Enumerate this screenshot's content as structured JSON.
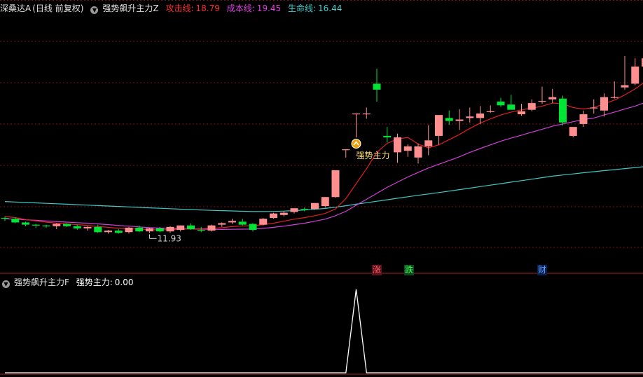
{
  "main_header": {
    "stock": "深桑达A",
    "period": "(日线 前复权)",
    "indicator": "强势飙升主力Z",
    "attack_label": "攻击线:",
    "attack_value": "18.79",
    "cost_label": "成本线:",
    "cost_value": "19.45",
    "life_label": "生命线:",
    "life_value": "16.44"
  },
  "sub_header": {
    "indicator": "强势飙升主力F",
    "strong_label": "强势主力:",
    "strong_value": "0.00"
  },
  "annotations": {
    "low_price": "11.93",
    "strong_signal": "强势主力",
    "rise_mark": "涨",
    "fall_mark": "跌",
    "money_mark": "财"
  },
  "colors": {
    "up": "#ff8f8f",
    "down": "#00e436",
    "attack": "#e02020",
    "cost": "#d040d8",
    "life": "#40c8c8",
    "grid": "#7a1616",
    "strong": "#ffffff",
    "label_yellow": "#ffe070"
  },
  "chart_data": {
    "type": "candlestick",
    "price_range": [
      10.6,
      26.1
    ],
    "candles": [
      [
        12.9,
        13.0,
        12.7,
        12.85
      ],
      [
        12.85,
        12.95,
        12.55,
        12.6
      ],
      [
        12.6,
        12.65,
        12.35,
        12.45
      ],
      [
        12.45,
        12.5,
        12.25,
        12.4
      ],
      [
        12.4,
        12.45,
        12.25,
        12.35
      ],
      [
        12.35,
        12.55,
        12.15,
        12.5
      ],
      [
        12.5,
        12.55,
        12.3,
        12.35
      ],
      [
        12.35,
        12.45,
        12.1,
        12.2
      ],
      [
        12.2,
        12.35,
        12.05,
        12.3
      ],
      [
        12.3,
        12.45,
        11.9,
        11.95
      ],
      [
        11.95,
        12.1,
        11.85,
        12.05
      ],
      [
        12.05,
        12.15,
        11.85,
        11.9
      ],
      [
        11.95,
        12.3,
        11.85,
        12.25
      ],
      [
        12.25,
        12.4,
        11.95,
        12.0
      ],
      [
        12.0,
        12.25,
        11.9,
        12.2
      ],
      [
        12.2,
        12.3,
        11.95,
        12.0
      ],
      [
        12.0,
        12.35,
        11.9,
        12.3
      ],
      [
        12.1,
        12.4,
        12.0,
        12.4
      ],
      [
        12.4,
        12.55,
        12.1,
        12.15
      ],
      [
        12.1,
        12.3,
        11.95,
        12.05
      ],
      [
        12.05,
        12.45,
        12.0,
        12.4
      ],
      [
        12.45,
        12.6,
        12.3,
        12.55
      ],
      [
        12.6,
        12.85,
        12.5,
        12.7
      ],
      [
        12.65,
        12.85,
        12.4,
        12.45
      ],
      [
        12.5,
        12.55,
        12.0,
        12.1
      ],
      [
        12.45,
        12.9,
        12.4,
        12.85
      ],
      [
        12.9,
        13.25,
        12.85,
        13.2
      ],
      [
        13.1,
        13.35,
        13.0,
        13.25
      ],
      [
        13.3,
        13.55,
        13.2,
        13.55
      ],
      [
        13.5,
        13.6,
        13.35,
        13.45
      ],
      [
        13.5,
        13.9,
        13.45,
        13.9
      ],
      [
        13.7,
        14.3,
        13.6,
        14.3
      ],
      [
        14.3,
        16.1,
        14.25,
        16.1
      ],
      [
        17.5,
        17.5,
        16.95,
        17.5
      ],
      [
        19.9,
        19.9,
        18.3,
        19.9
      ],
      [
        19.85,
        20.3,
        19.55,
        19.9
      ],
      [
        21.9,
        22.9,
        20.7,
        21.5
      ],
      [
        18.4,
        19.0,
        17.95,
        18.3
      ],
      [
        17.3,
        18.55,
        16.6,
        18.3
      ],
      [
        17.4,
        17.85,
        17.0,
        17.7
      ],
      [
        16.95,
        17.9,
        16.55,
        17.7
      ],
      [
        17.7,
        19.1,
        17.1,
        18.1
      ],
      [
        18.4,
        19.5,
        17.8,
        19.8
      ],
      [
        19.6,
        20.1,
        19.15,
        19.4
      ],
      [
        19.4,
        20.2,
        18.8,
        19.5
      ],
      [
        19.6,
        20.3,
        19.3,
        19.7
      ],
      [
        19.6,
        20.4,
        19.2,
        19.9
      ],
      [
        20.05,
        20.45,
        19.95,
        20.05
      ],
      [
        20.7,
        20.95,
        20.35,
        20.45
      ],
      [
        20.5,
        21.15,
        20.35,
        20.15
      ],
      [
        19.85,
        20.55,
        19.75,
        20.05
      ],
      [
        20.15,
        20.85,
        20.05,
        20.6
      ],
      [
        20.7,
        21.7,
        20.55,
        20.75
      ],
      [
        20.85,
        21.55,
        20.6,
        21.0
      ],
      [
        20.9,
        21.1,
        19.1,
        19.3
      ],
      [
        18.4,
        18.95,
        18.3,
        19.0
      ],
      [
        19.2,
        20.1,
        19.0,
        19.85
      ],
      [
        20.25,
        20.85,
        19.9,
        20.3
      ],
      [
        20.1,
        21.25,
        19.7,
        21.0
      ],
      [
        21.0,
        22.05,
        20.9,
        21.0
      ],
      [
        21.65,
        23.75,
        21.5,
        21.8
      ],
      [
        21.9,
        23.6,
        21.8,
        23.05
      ],
      [
        23.05,
        25.4,
        23.0,
        23.6
      ],
      [
        25.25,
        25.65,
        25.1,
        25.95
      ]
    ],
    "attack_line": [
      13.0,
      12.92,
      12.8,
      12.7,
      12.62,
      12.55,
      12.5,
      12.45,
      12.4,
      12.33,
      12.27,
      12.2,
      12.17,
      12.16,
      12.12,
      12.1,
      12.12,
      12.15,
      12.17,
      12.18,
      12.2,
      12.25,
      12.32,
      12.37,
      12.38,
      12.45,
      12.55,
      12.68,
      12.82,
      12.92,
      13.05,
      13.2,
      13.5,
      14.2,
      15.2,
      16.2,
      17.3,
      17.9,
      18.2,
      18.3,
      17.85,
      17.6,
      17.8,
      18.15,
      18.5,
      18.9,
      19.25,
      19.55,
      19.8,
      20.0,
      20.15,
      20.25,
      20.4,
      20.6,
      20.55,
      20.3,
      20.2,
      20.3,
      20.55,
      20.8,
      21.15,
      21.55,
      22.05,
      22.6
    ],
    "cost_line": [
      12.85,
      12.82,
      12.78,
      12.74,
      12.7,
      12.66,
      12.62,
      12.58,
      12.55,
      12.5,
      12.45,
      12.4,
      12.35,
      12.3,
      12.25,
      12.22,
      12.2,
      12.18,
      12.16,
      12.15,
      12.14,
      12.13,
      12.14,
      12.15,
      12.16,
      12.2,
      12.27,
      12.35,
      12.45,
      12.55,
      12.68,
      12.82,
      13.05,
      13.35,
      13.75,
      14.15,
      14.55,
      14.95,
      15.3,
      15.65,
      15.95,
      16.25,
      16.5,
      16.75,
      17.0,
      17.3,
      17.55,
      17.8,
      18.05,
      18.25,
      18.45,
      18.65,
      18.85,
      19.05,
      19.2,
      19.35,
      19.5,
      19.6,
      19.8,
      20.0,
      20.2,
      20.4,
      20.65,
      20.9
    ],
    "life_line": [
      14.0,
      13.97,
      13.94,
      13.91,
      13.88,
      13.85,
      13.82,
      13.79,
      13.76,
      13.73,
      13.7,
      13.67,
      13.64,
      13.61,
      13.58,
      13.55,
      13.52,
      13.49,
      13.46,
      13.43,
      13.41,
      13.39,
      13.37,
      13.35,
      13.33,
      13.33,
      13.34,
      13.36,
      13.39,
      13.43,
      13.48,
      13.54,
      13.62,
      13.72,
      13.82,
      13.92,
      14.02,
      14.12,
      14.22,
      14.32,
      14.42,
      14.51,
      14.6,
      14.7,
      14.8,
      14.9,
      15.0,
      15.1,
      15.2,
      15.3,
      15.4,
      15.5,
      15.6,
      15.7,
      15.78,
      15.85,
      15.93,
      16.0,
      16.07,
      16.14,
      16.21,
      16.28,
      16.35,
      16.44
    ],
    "strong_main": [
      0,
      0,
      0,
      0,
      0,
      0,
      0,
      0,
      0,
      0,
      0,
      0,
      0,
      0,
      0,
      0,
      0,
      0,
      0,
      0,
      0,
      0,
      0,
      0,
      0,
      0,
      0,
      0,
      0,
      0,
      0,
      0,
      0,
      0,
      1,
      0,
      0,
      0,
      0,
      0,
      0,
      0,
      0,
      0,
      0,
      0,
      0,
      0,
      0,
      0,
      0,
      0,
      0,
      0,
      0,
      0,
      0,
      0,
      0,
      0,
      0,
      0,
      0,
      0
    ],
    "signal_index": 34,
    "low_index": 14
  }
}
